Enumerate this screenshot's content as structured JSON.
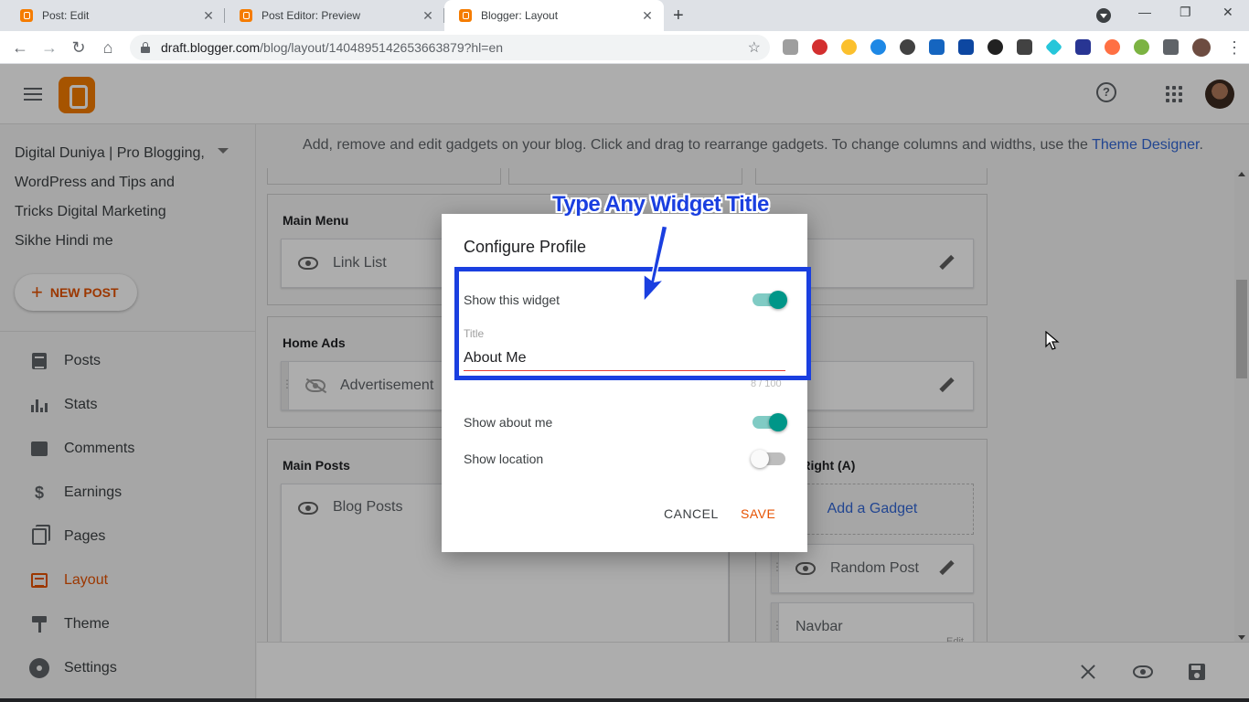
{
  "browser": {
    "tabs": [
      {
        "title": "Post: Edit"
      },
      {
        "title": "Post Editor: Preview"
      },
      {
        "title": "Blogger: Layout"
      }
    ],
    "url_host": "draft.blogger.com",
    "url_path": "/blog/layout/1404895142653663879?hl=en"
  },
  "blog": {
    "title": "Digital Duniya | Pro Blogging, WordPress and Tips and Tricks Digital Marketing Sikhe Hindi me",
    "new_post": "NEW POST"
  },
  "nav": [
    {
      "label": "Posts",
      "icon": "posts-icon"
    },
    {
      "label": "Stats",
      "icon": "stats-icon"
    },
    {
      "label": "Comments",
      "icon": "comments-icon"
    },
    {
      "label": "Earnings",
      "icon": "dollar-icon"
    },
    {
      "label": "Pages",
      "icon": "pages-icon"
    },
    {
      "label": "Layout",
      "icon": "layout-icon",
      "active": true
    },
    {
      "label": "Theme",
      "icon": "paint-roller-icon"
    },
    {
      "label": "Settings",
      "icon": "gear-icon"
    }
  ],
  "main": {
    "hint": "Add, remove and edit gadgets on your blog. Click and drag to rearrange gadgets. To change columns and widths, use the",
    "hint_link": "Theme Designer",
    "hint_end": ".",
    "sections": {
      "main_menu": {
        "title": "Main Menu",
        "gadget": "Link List"
      },
      "home_ads": {
        "title": "Home Ads",
        "gadget": "Advertisement"
      },
      "main_posts": {
        "title": "Main Posts",
        "gadget": "Blog Posts"
      },
      "sidebar_right": {
        "title_partial": "r Right (A)",
        "add_gadget": "Add a Gadget",
        "gadgets": [
          "Random Post",
          "Navbar"
        ],
        "navbar_edit": "Edit"
      }
    }
  },
  "dialog": {
    "title": "Configure Profile",
    "show_widget": {
      "label": "Show this widget",
      "on": true
    },
    "title_field": {
      "label": "Title",
      "value": "About Me",
      "counter": "8 / 100"
    },
    "show_about": {
      "label": "Show about me",
      "on": true
    },
    "show_location": {
      "label": "Show location",
      "on": false
    },
    "cancel": "CANCEL",
    "save": "SAVE"
  },
  "annotation": {
    "text": "Type Any Widget Title",
    "color": "#1a3fe0"
  },
  "colors": {
    "accent": "#e65100",
    "toggle_on": "#009688",
    "link": "#3367d6"
  }
}
